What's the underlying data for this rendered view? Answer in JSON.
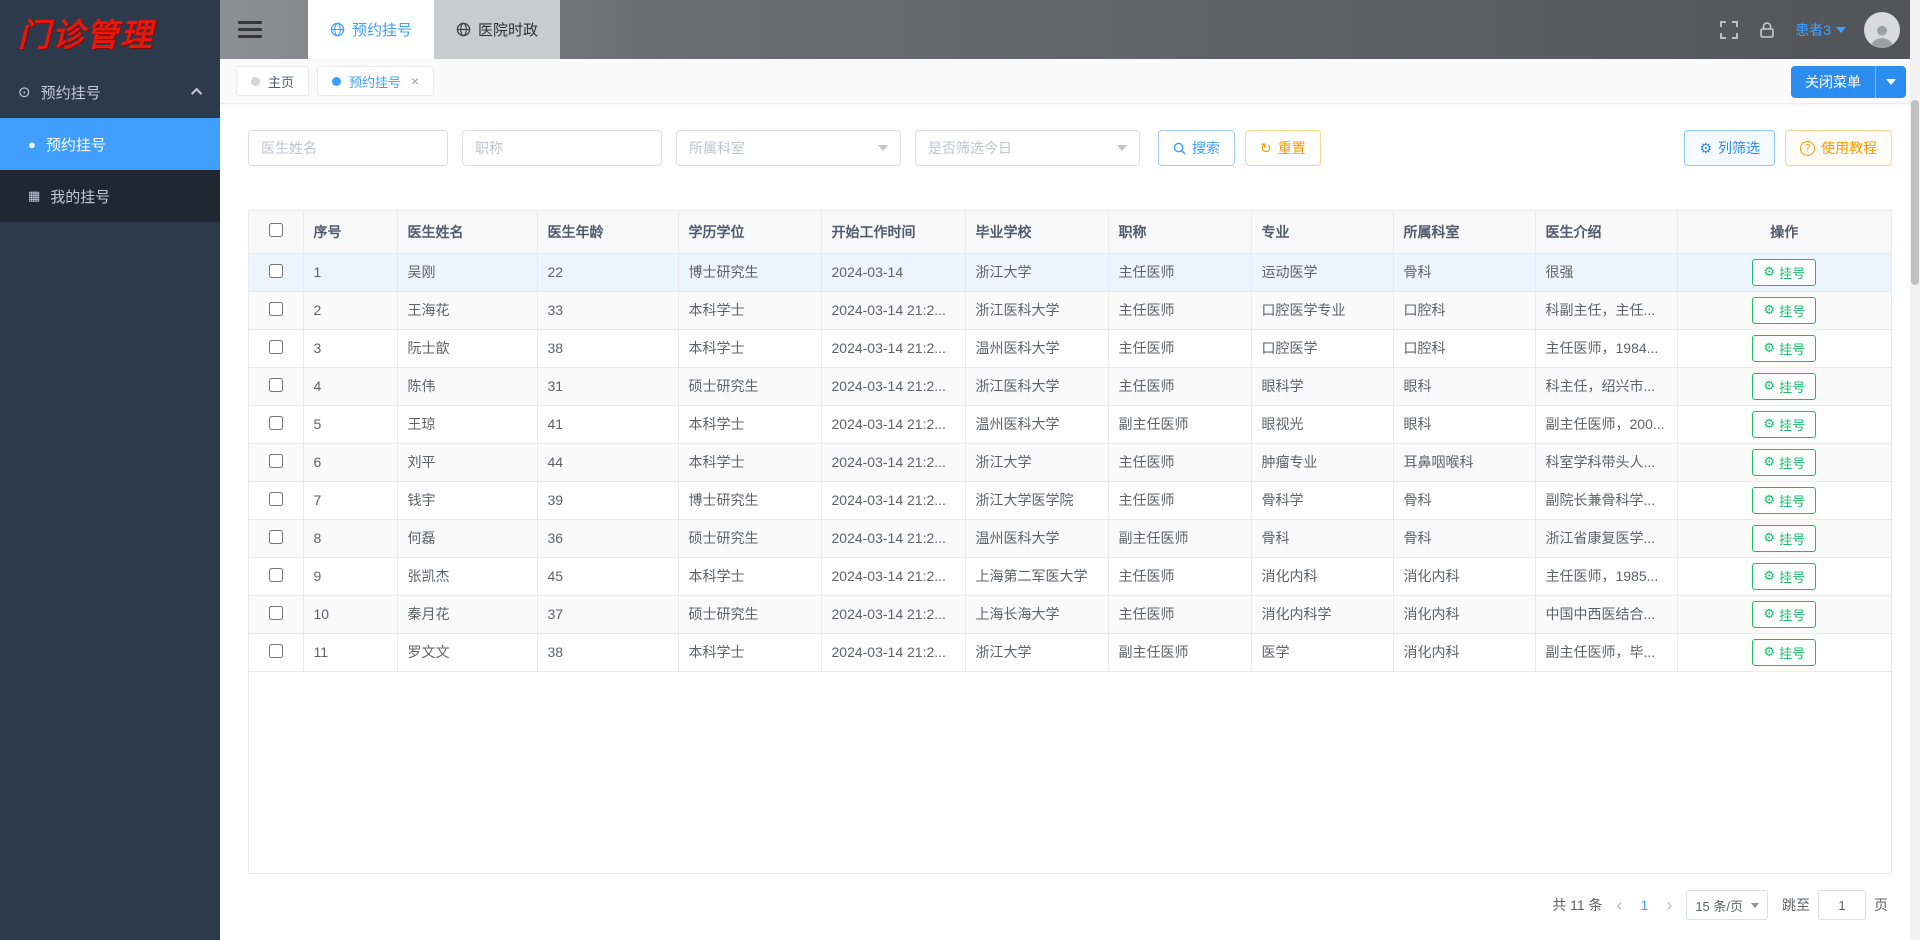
{
  "colors": {
    "accent": "#409eff",
    "button_blue": "#2d8cf0",
    "green": "#19be6b",
    "orange": "#ff9900",
    "sidebar_bg": "#2d3a4b",
    "sidebar_submenu_bg": "#1f2733",
    "logo_red": "#e8160c",
    "row_highlight": "#ecf5ff"
  },
  "icons": {
    "gear": "⚙",
    "refresh": "↻",
    "menu_group": "⊙",
    "item_appointment": "●",
    "item_my": "▦",
    "tab_close": "×",
    "prev": "‹",
    "next": "›",
    "question": "?"
  },
  "app": {
    "logo": "门诊管理"
  },
  "sidebar": {
    "group_label": "预约挂号",
    "items": [
      {
        "label": "预约挂号",
        "active": true
      },
      {
        "label": "我的挂号",
        "active": false
      }
    ]
  },
  "header": {
    "nav_tabs": [
      {
        "label": "预约挂号",
        "active": true
      },
      {
        "label": "医院时政",
        "active": false
      }
    ],
    "user": {
      "name": "患者3"
    }
  },
  "tagbar": {
    "tabs": [
      {
        "label": "主页",
        "active": false
      },
      {
        "label": "预约挂号",
        "active": true
      }
    ],
    "close_menu_label": "关闭菜单"
  },
  "filters": {
    "doctor_name_placeholder": "医生姓名",
    "title_placeholder": "职称",
    "department_placeholder": "所属科室",
    "today_placeholder": "是否筛选今日",
    "search_label": "搜索",
    "reset_label": "重置",
    "column_filter_label": "列筛选",
    "tutorial_label": "使用教程"
  },
  "table": {
    "columns": [
      "序号",
      "医生姓名",
      "医生年龄",
      "学历学位",
      "开始工作时间",
      "毕业学校",
      "职称",
      "专业",
      "所属科室",
      "医生介绍",
      "操作"
    ],
    "action_label": "挂号",
    "rows": [
      {
        "cells": [
          "1",
          "吴刚",
          "22",
          "博士研究生",
          "2024-03-14",
          "浙江大学",
          "主任医师",
          "运动医学",
          "骨科",
          "很强"
        ]
      },
      {
        "cells": [
          "2",
          "王海花",
          "33",
          "本科学士",
          "2024-03-14 21:2...",
          "浙江医科大学",
          "主任医师",
          "口腔医学专业",
          "口腔科",
          "科副主任，主任..."
        ]
      },
      {
        "cells": [
          "3",
          "阮士歆",
          "38",
          "本科学士",
          "2024-03-14 21:2...",
          "温州医科大学",
          "主任医师",
          "口腔医学",
          "口腔科",
          "主任医师，1984..."
        ]
      },
      {
        "cells": [
          "4",
          "陈伟",
          "31",
          "硕士研究生",
          "2024-03-14 21:2...",
          "浙江医科大学",
          "主任医师",
          "眼科学",
          "眼科",
          "科主任，绍兴市..."
        ]
      },
      {
        "cells": [
          "5",
          "王琼",
          "41",
          "本科学士",
          "2024-03-14 21:2...",
          "温州医科大学",
          "副主任医师",
          "眼视光",
          "眼科",
          "副主任医师，200..."
        ]
      },
      {
        "cells": [
          "6",
          "刘平",
          "44",
          "本科学士",
          "2024-03-14 21:2...",
          "浙江大学",
          "主任医师",
          "肿瘤专业",
          "耳鼻咽喉科",
          "科室学科带头人..."
        ]
      },
      {
        "cells": [
          "7",
          "钱宇",
          "39",
          "博士研究生",
          "2024-03-14 21:2...",
          "浙江大学医学院",
          "主任医师",
          "骨科学",
          "骨科",
          "副院长兼骨科学..."
        ]
      },
      {
        "cells": [
          "8",
          "何磊",
          "36",
          "硕士研究生",
          "2024-03-14 21:2...",
          "温州医科大学",
          "副主任医师",
          "骨科",
          "骨科",
          "浙江省康复医学..."
        ]
      },
      {
        "cells": [
          "9",
          "张凯杰",
          "45",
          "本科学士",
          "2024-03-14 21:2...",
          "上海第二军医大学",
          "主任医师",
          "消化内科",
          "消化内科",
          "主任医师，1985..."
        ]
      },
      {
        "cells": [
          "10",
          "秦月花",
          "37",
          "硕士研究生",
          "2024-03-14 21:2...",
          "上海长海大学",
          "主任医师",
          "消化内科学",
          "消化内科",
          "中国中西医结合..."
        ]
      },
      {
        "cells": [
          "11",
          "罗文文",
          "38",
          "本科学士",
          "2024-03-14 21:2...",
          "浙江大学",
          "副主任医师",
          "医学",
          "消化内科",
          "副主任医师，毕..."
        ]
      }
    ]
  },
  "pagination": {
    "total_label": "共 11 条",
    "current_page": "1",
    "page_size_label": "15 条/页",
    "jump_label": "跳至",
    "jump_value": "1",
    "page_suffix": "页"
  }
}
